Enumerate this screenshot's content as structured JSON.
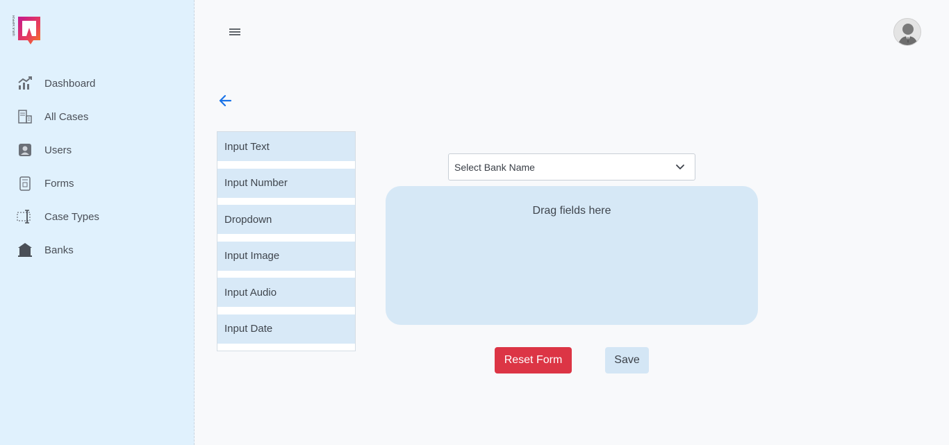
{
  "sidebar": {
    "logo_icon": "quick-support-logo",
    "items": [
      {
        "label": "Dashboard",
        "icon": "dashboard-chart-icon"
      },
      {
        "label": "All Cases",
        "icon": "all-cases-icon"
      },
      {
        "label": "Users",
        "icon": "user-icon"
      },
      {
        "label": "Forms",
        "icon": "forms-icon"
      },
      {
        "label": "Case Types",
        "icon": "case-types-icon"
      },
      {
        "label": "Banks",
        "icon": "bank-icon"
      }
    ]
  },
  "header": {
    "menu_icon": "hamburger-icon",
    "avatar_icon": "user-avatar"
  },
  "back_icon": "arrow-left-icon",
  "palette": {
    "fields": [
      {
        "label": "Input Text"
      },
      {
        "label": "Input Number"
      },
      {
        "label": "Dropdown"
      },
      {
        "label": "Input Image"
      },
      {
        "label": "Input Audio"
      },
      {
        "label": "Input Date"
      }
    ]
  },
  "form_builder": {
    "bank_select_value": "Select Bank Name",
    "dropzone_text": "Drag fields here",
    "reset_label": "Reset Form",
    "save_label": "Save"
  },
  "colors": {
    "sidebar_bg": "#e0f1fd",
    "accent_blue": "#1a73e8",
    "danger": "#dc3545",
    "dropzone_bg": "#d6e8f6"
  }
}
